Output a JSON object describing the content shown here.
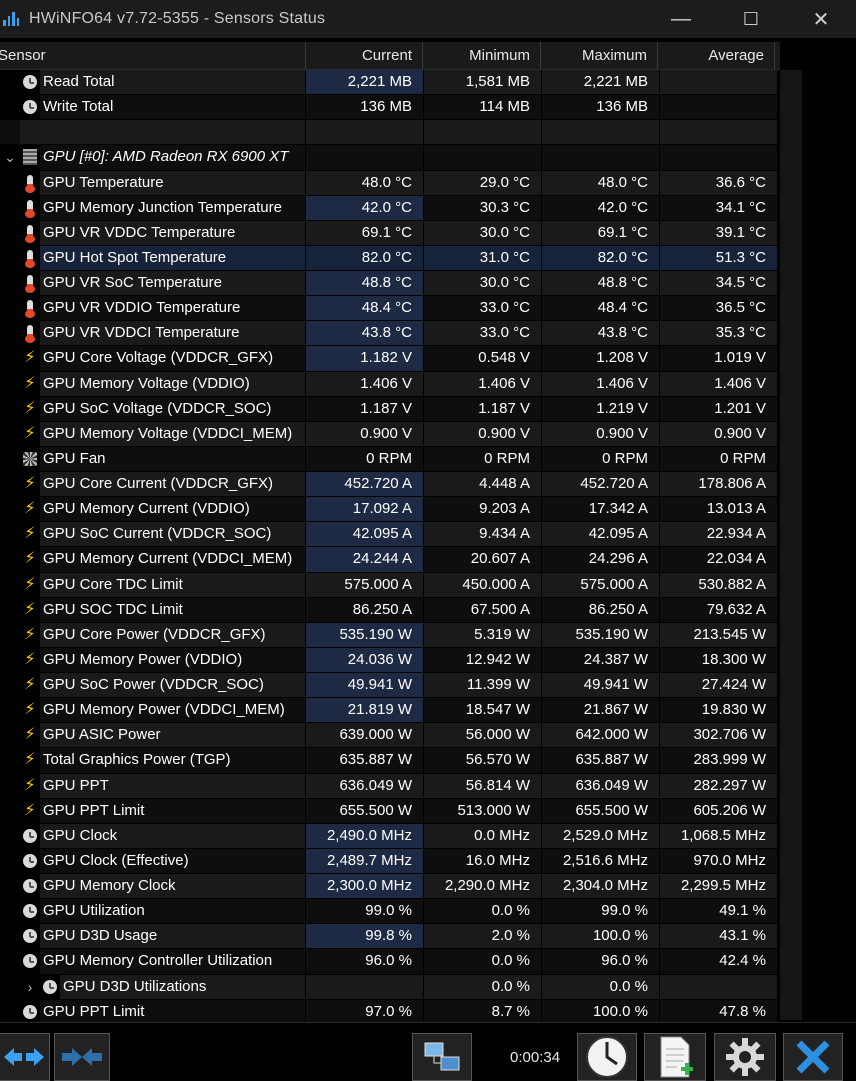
{
  "window": {
    "title": "HWiNFO64 v7.72-5355 - Sensors Status",
    "controls": {
      "minimize": "—",
      "maximize": "☐",
      "close": "✕"
    }
  },
  "columns": {
    "sensor": "Sensor",
    "current": "Current",
    "minimum": "Minimum",
    "maximum": "Maximum",
    "average": "Average"
  },
  "rows": [
    {
      "type": "sensor",
      "icon": "clock",
      "name": "Read Total",
      "current": "2,221 MB",
      "minimum": "1,581 MB",
      "maximum": "2,221 MB",
      "average": "",
      "hl": true
    },
    {
      "type": "sensor",
      "icon": "clock",
      "name": "Write Total",
      "current": "136 MB",
      "minimum": "114 MB",
      "maximum": "136 MB",
      "average": ""
    },
    {
      "type": "spacer"
    },
    {
      "type": "group",
      "icon": "chip",
      "name": "GPU [#0]: AMD Radeon RX 6900 XT"
    },
    {
      "type": "sensor",
      "icon": "therm",
      "name": "GPU Temperature",
      "current": "48.0 °C",
      "minimum": "29.0 °C",
      "maximum": "48.0 °C",
      "average": "36.6 °C"
    },
    {
      "type": "sensor",
      "icon": "therm",
      "name": "GPU Memory Junction Temperature",
      "current": "42.0 °C",
      "minimum": "30.3 °C",
      "maximum": "42.0 °C",
      "average": "34.1 °C",
      "hl": true
    },
    {
      "type": "sensor",
      "icon": "therm",
      "name": "GPU VR VDDC Temperature",
      "current": "69.1 °C",
      "minimum": "30.0 °C",
      "maximum": "69.1 °C",
      "average": "39.1 °C"
    },
    {
      "type": "sensor",
      "icon": "therm",
      "name": "GPU Hot Spot Temperature",
      "current": "82.0 °C",
      "minimum": "31.0 °C",
      "maximum": "82.0 °C",
      "average": "51.3 °C",
      "selected": true
    },
    {
      "type": "sensor",
      "icon": "therm",
      "name": "GPU VR SoC Temperature",
      "current": "48.8 °C",
      "minimum": "30.0 °C",
      "maximum": "48.8 °C",
      "average": "34.5 °C",
      "hl": true
    },
    {
      "type": "sensor",
      "icon": "therm",
      "name": "GPU VR VDDIO Temperature",
      "current": "48.4 °C",
      "minimum": "33.0 °C",
      "maximum": "48.4 °C",
      "average": "36.5 °C",
      "hl": true
    },
    {
      "type": "sensor",
      "icon": "therm",
      "name": "GPU VR VDDCI Temperature",
      "current": "43.8 °C",
      "minimum": "33.0 °C",
      "maximum": "43.8 °C",
      "average": "35.3 °C",
      "hl": true
    },
    {
      "type": "sensor",
      "icon": "bolt",
      "name": "GPU Core Voltage (VDDCR_GFX)",
      "current": "1.182 V",
      "minimum": "0.548 V",
      "maximum": "1.208 V",
      "average": "1.019 V",
      "hl": true
    },
    {
      "type": "sensor",
      "icon": "bolt",
      "name": "GPU Memory Voltage (VDDIO)",
      "current": "1.406 V",
      "minimum": "1.406 V",
      "maximum": "1.406 V",
      "average": "1.406 V"
    },
    {
      "type": "sensor",
      "icon": "bolt",
      "name": "GPU SoC Voltage (VDDCR_SOC)",
      "current": "1.187 V",
      "minimum": "1.187 V",
      "maximum": "1.219 V",
      "average": "1.201 V"
    },
    {
      "type": "sensor",
      "icon": "bolt",
      "name": "GPU Memory Voltage (VDDCI_MEM)",
      "current": "0.900 V",
      "minimum": "0.900 V",
      "maximum": "0.900 V",
      "average": "0.900 V"
    },
    {
      "type": "sensor",
      "icon": "fan",
      "name": "GPU Fan",
      "current": "0 RPM",
      "minimum": "0 RPM",
      "maximum": "0 RPM",
      "average": "0 RPM"
    },
    {
      "type": "sensor",
      "icon": "bolt",
      "name": "GPU Core Current (VDDCR_GFX)",
      "current": "452.720 A",
      "minimum": "4.448 A",
      "maximum": "452.720 A",
      "average": "178.806 A",
      "hl": true
    },
    {
      "type": "sensor",
      "icon": "bolt",
      "name": "GPU Memory Current (VDDIO)",
      "current": "17.092 A",
      "minimum": "9.203 A",
      "maximum": "17.342 A",
      "average": "13.013 A",
      "hl": true
    },
    {
      "type": "sensor",
      "icon": "bolt",
      "name": "GPU SoC Current (VDDCR_SOC)",
      "current": "42.095 A",
      "minimum": "9.434 A",
      "maximum": "42.095 A",
      "average": "22.934 A",
      "hl": true
    },
    {
      "type": "sensor",
      "icon": "bolt",
      "name": "GPU Memory Current (VDDCI_MEM)",
      "current": "24.244 A",
      "minimum": "20.607 A",
      "maximum": "24.296 A",
      "average": "22.034 A",
      "hl": true
    },
    {
      "type": "sensor",
      "icon": "bolt",
      "name": "GPU Core TDC Limit",
      "current": "575.000 A",
      "minimum": "450.000 A",
      "maximum": "575.000 A",
      "average": "530.882 A"
    },
    {
      "type": "sensor",
      "icon": "bolt",
      "name": "GPU SOC TDC Limit",
      "current": "86.250 A",
      "minimum": "67.500 A",
      "maximum": "86.250 A",
      "average": "79.632 A"
    },
    {
      "type": "sensor",
      "icon": "bolt",
      "name": "GPU Core Power (VDDCR_GFX)",
      "current": "535.190 W",
      "minimum": "5.319 W",
      "maximum": "535.190 W",
      "average": "213.545 W",
      "hl": true
    },
    {
      "type": "sensor",
      "icon": "bolt",
      "name": "GPU Memory Power (VDDIO)",
      "current": "24.036 W",
      "minimum": "12.942 W",
      "maximum": "24.387 W",
      "average": "18.300 W",
      "hl": true
    },
    {
      "type": "sensor",
      "icon": "bolt",
      "name": "GPU SoC Power (VDDCR_SOC)",
      "current": "49.941 W",
      "minimum": "11.399 W",
      "maximum": "49.941 W",
      "average": "27.424 W",
      "hl": true
    },
    {
      "type": "sensor",
      "icon": "bolt",
      "name": "GPU Memory Power (VDDCI_MEM)",
      "current": "21.819 W",
      "minimum": "18.547 W",
      "maximum": "21.867 W",
      "average": "19.830 W",
      "hl": true
    },
    {
      "type": "sensor",
      "icon": "bolt",
      "name": "GPU ASIC Power",
      "current": "639.000 W",
      "minimum": "56.000 W",
      "maximum": "642.000 W",
      "average": "302.706 W"
    },
    {
      "type": "sensor",
      "icon": "bolt",
      "name": "Total Graphics Power (TGP)",
      "current": "635.887 W",
      "minimum": "56.570 W",
      "maximum": "635.887 W",
      "average": "283.999 W"
    },
    {
      "type": "sensor",
      "icon": "bolt",
      "name": "GPU PPT",
      "current": "636.049 W",
      "minimum": "56.814 W",
      "maximum": "636.049 W",
      "average": "282.297 W"
    },
    {
      "type": "sensor",
      "icon": "bolt",
      "name": "GPU PPT Limit",
      "current": "655.500 W",
      "minimum": "513.000 W",
      "maximum": "655.500 W",
      "average": "605.206 W"
    },
    {
      "type": "sensor",
      "icon": "clock",
      "name": "GPU Clock",
      "current": "2,490.0 MHz",
      "minimum": "0.0 MHz",
      "maximum": "2,529.0 MHz",
      "average": "1,068.5 MHz",
      "hl": true
    },
    {
      "type": "sensor",
      "icon": "clock",
      "name": "GPU Clock (Effective)",
      "current": "2,489.7 MHz",
      "minimum": "16.0 MHz",
      "maximum": "2,516.6 MHz",
      "average": "970.0 MHz",
      "hl": true
    },
    {
      "type": "sensor",
      "icon": "clock",
      "name": "GPU Memory Clock",
      "current": "2,300.0 MHz",
      "minimum": "2,290.0 MHz",
      "maximum": "2,304.0 MHz",
      "average": "2,299.5 MHz",
      "hl": true
    },
    {
      "type": "sensor",
      "icon": "clock",
      "name": "GPU Utilization",
      "current": "99.0 %",
      "minimum": "0.0 %",
      "maximum": "99.0 %",
      "average": "49.1 %"
    },
    {
      "type": "sensor",
      "icon": "clock",
      "name": "GPU D3D Usage",
      "current": "99.8 %",
      "minimum": "2.0 %",
      "maximum": "100.0 %",
      "average": "43.1 %",
      "hl": true
    },
    {
      "type": "sensor",
      "icon": "clock",
      "name": "GPU Memory Controller Utilization",
      "current": "96.0 %",
      "minimum": "0.0 %",
      "maximum": "96.0 %",
      "average": "42.4 %"
    },
    {
      "type": "subgroup",
      "icon": "clock",
      "name": "GPU D3D Utilizations",
      "current": "",
      "minimum": "0.0 %",
      "maximum": "0.0 %",
      "average": ""
    },
    {
      "type": "sensor",
      "icon": "clock",
      "name": "GPU PPT Limit",
      "current": "97.0 %",
      "minimum": "8.7 %",
      "maximum": "100.0 %",
      "average": "47.8 %"
    }
  ],
  "toolbar": {
    "timer": "0:00:34",
    "buttons": [
      "expand-icon",
      "collapse-icon",
      "network-icon",
      "clock-icon",
      "report-icon",
      "gear-icon",
      "close-icon"
    ]
  }
}
